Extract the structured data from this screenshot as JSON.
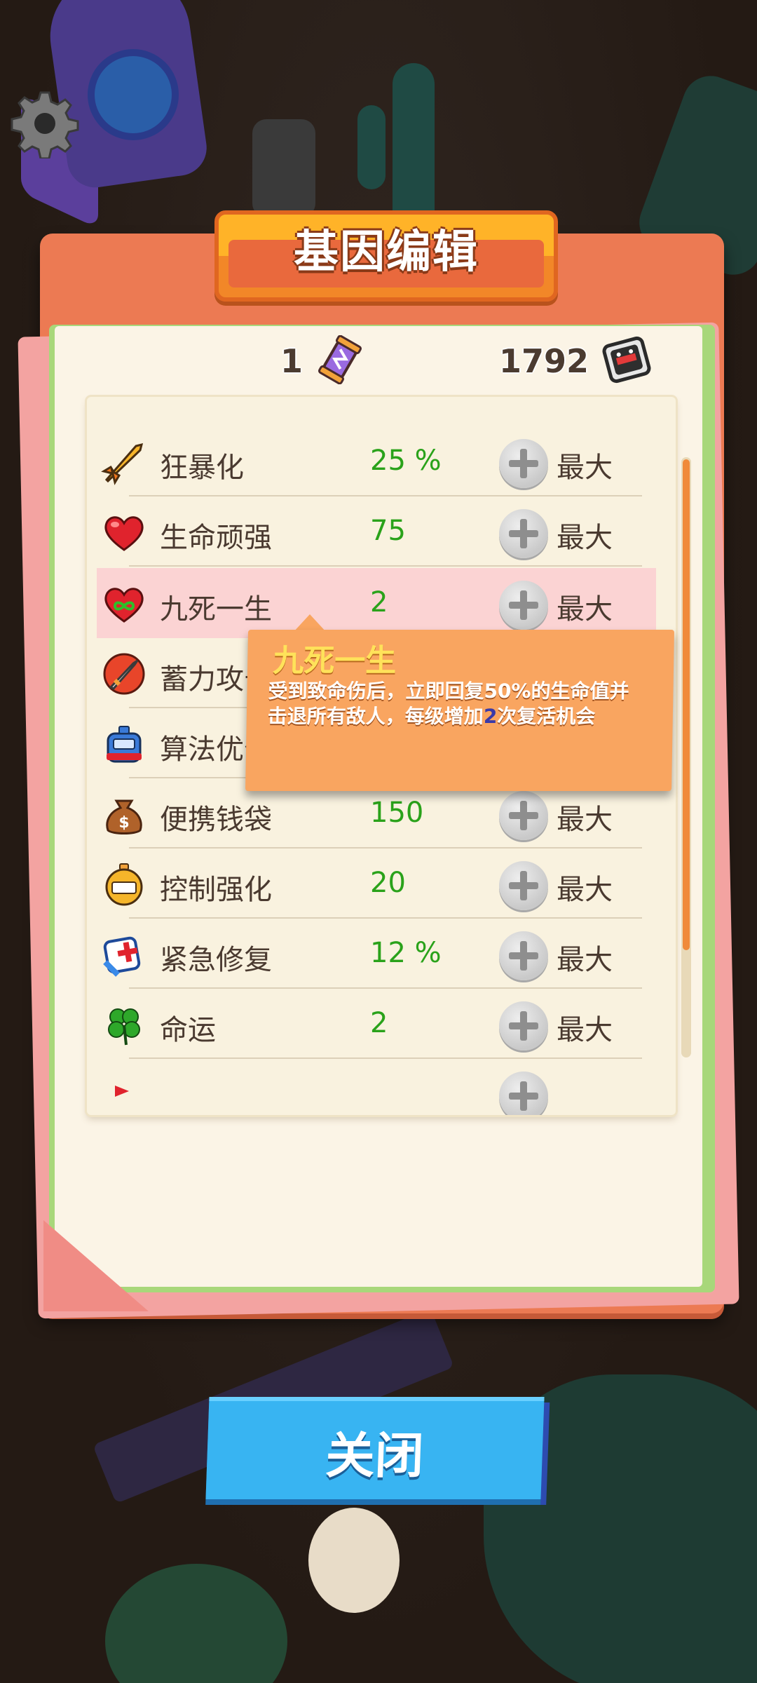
{
  "panel": {
    "title": "基因编辑"
  },
  "currencies": {
    "dna_count": "1",
    "chip_count": "1792"
  },
  "genes": [
    {
      "name": "狂暴化",
      "value": "25 %",
      "action": "最大",
      "icon": "rocket-icon"
    },
    {
      "name": "生命顽强",
      "value": "75",
      "action": "最大",
      "icon": "heart-icon"
    },
    {
      "name": "九死一生",
      "value": "2",
      "action": "最大",
      "icon": "heart-infinity-icon"
    },
    {
      "name": "蓄力攻击",
      "value": "",
      "action": "最大",
      "icon": "sword-icon"
    },
    {
      "name": "算法优化",
      "value": "",
      "action": "最大",
      "icon": "timer-robot-icon"
    },
    {
      "name": "便携钱袋",
      "value": "150",
      "action": "最大",
      "icon": "money-bag-icon"
    },
    {
      "name": "控制强化",
      "value": "20",
      "action": "最大",
      "icon": "stopwatch-icon"
    },
    {
      "name": "紧急修复",
      "value": "12 %",
      "action": "最大",
      "icon": "first-aid-icon"
    },
    {
      "name": "命运",
      "value": "2",
      "action": "最大",
      "icon": "clover-icon"
    }
  ],
  "selected_gene_index": 2,
  "tooltip": {
    "title": "九死一生",
    "desc_line1": "受到致命伤后，立即回复50%的生命值并",
    "desc_line2_a": "击退所有敌人，每级增加",
    "desc_line2_num": "2",
    "desc_line2_b": "次复活机会"
  },
  "close_button": {
    "label": "关闭"
  },
  "colors": {
    "panel": "#ec7a53",
    "value_green": "#2aa21a",
    "tooltip": "#f9a560",
    "close_button": "#38b4f2"
  }
}
